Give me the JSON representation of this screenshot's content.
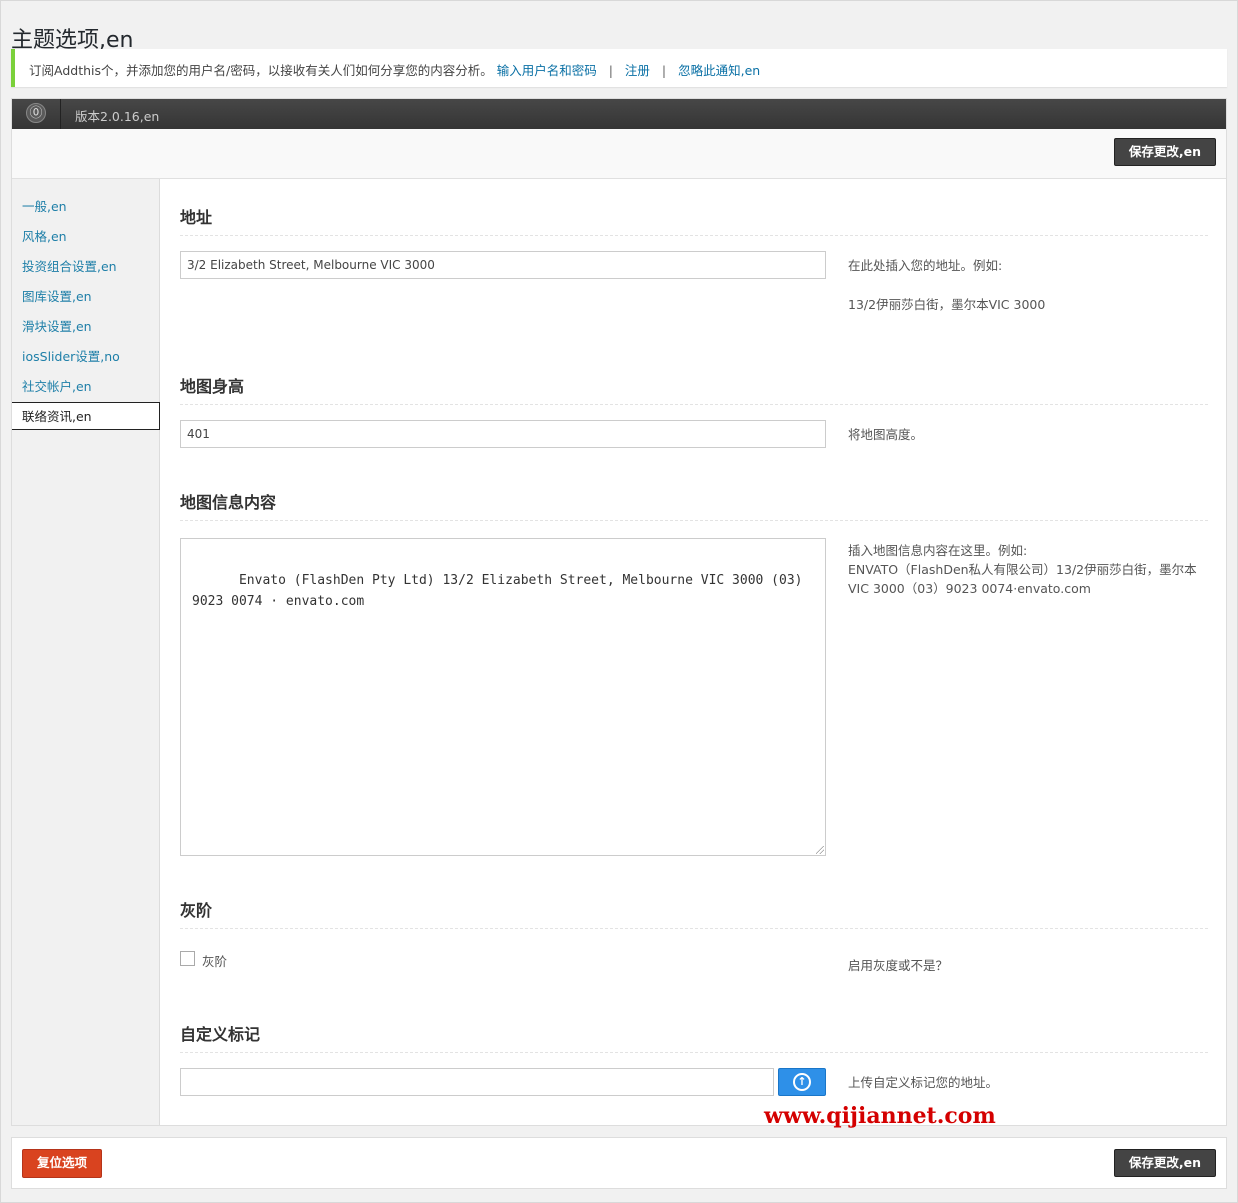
{
  "page_title": "主题选项,en",
  "notice": {
    "text": "订阅Addthis个，并添加您的用户名/密码，以接收有关人们如何分享您的内容分析。",
    "links": [
      "输入用户名和密码",
      "注册",
      "忽略此通知,en"
    ],
    "separator": "|"
  },
  "topbar": {
    "logo_icon": "theme-logo-icon",
    "version": "版本2.0.16,en"
  },
  "buttons": {
    "save": "保存更改,en",
    "reset": "复位选项"
  },
  "sidebar": {
    "items": [
      {
        "label": "一般,en"
      },
      {
        "label": "风格,en"
      },
      {
        "label": "投资组合设置,en"
      },
      {
        "label": "图库设置,en"
      },
      {
        "label": "滑块设置,en"
      },
      {
        "label": "iosSlider设置,no"
      },
      {
        "label": "社交帐户,en"
      },
      {
        "label": "联络资讯,en",
        "active": true
      }
    ]
  },
  "sections": {
    "address": {
      "title": "地址",
      "value": "3/2 Elizabeth Street, Melbourne VIC 3000",
      "desc1": "在此处插入您的地址。例如:",
      "desc2": "13/2伊丽莎白街，墨尔本VIC 3000"
    },
    "map_height": {
      "title": "地图身高",
      "value": "401",
      "desc": "将地图高度。"
    },
    "map_info": {
      "title": "地图信息内容",
      "value": "Envato (FlashDen Pty Ltd) 13/2 Elizabeth Street, Melbourne VIC 3000 (03) 9023 0074 · envato.com",
      "desc1": "插入地图信息内容在这里。例如:",
      "desc2": "ENVATO（FlashDen私人有限公司）13/2伊丽莎白街，墨尔本VIC 3000（03）9023 0074·envato.com"
    },
    "grayscale": {
      "title": "灰阶",
      "checkbox_label": "灰阶",
      "checked": false,
      "desc": "启用灰度或不是？"
    },
    "custom_marker": {
      "title": "自定义标记",
      "value": "",
      "upload_icon": "upload-arrow-icon",
      "desc": "上传自定义标记您的地址。"
    }
  },
  "watermark": "www.qijiannet.com"
}
